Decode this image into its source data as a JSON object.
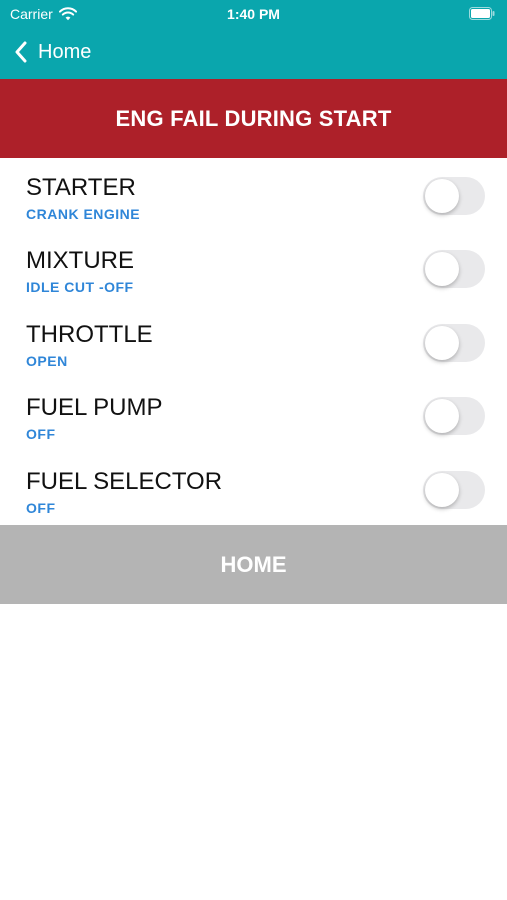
{
  "status_bar": {
    "carrier": "Carrier",
    "time": "1:40 PM"
  },
  "nav": {
    "back_label": "Home"
  },
  "banner": {
    "title": "ENG FAIL DURING START"
  },
  "checklist": [
    {
      "title": "STARTER",
      "action": "CRANK ENGINE",
      "checked": false
    },
    {
      "title": "MIXTURE",
      "action": "IDLE CUT -OFF",
      "checked": false
    },
    {
      "title": "THROTTLE",
      "action": "OPEN",
      "checked": false
    },
    {
      "title": "FUEL PUMP",
      "action": "OFF",
      "checked": false
    },
    {
      "title": "FUEL SELECTOR",
      "action": "OFF",
      "checked": false
    }
  ],
  "home_button": {
    "label": "HOME"
  },
  "colors": {
    "header": "#0aa6ad",
    "banner": "#ad2029",
    "action_text": "#2f86d8",
    "home_button": "#b4b4b4"
  }
}
